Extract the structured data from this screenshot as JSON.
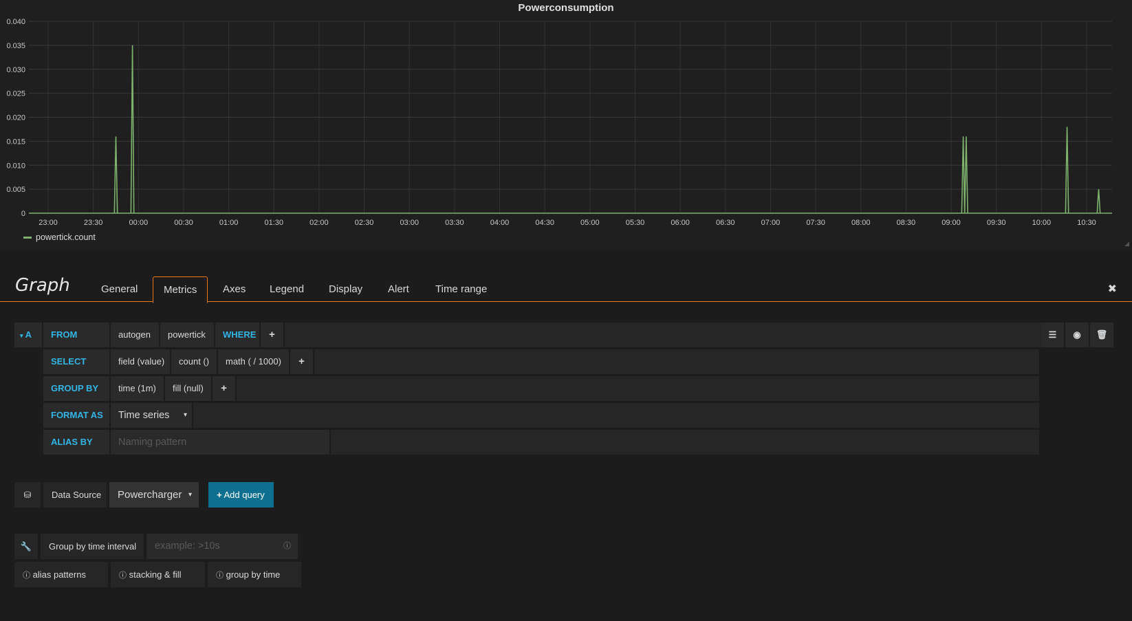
{
  "panel": {
    "title": "Powerconsumption",
    "legend_label": "powertick.count",
    "series_color": "#7eb26d"
  },
  "chart_data": {
    "type": "line",
    "x_ticks": [
      "23:00",
      "23:30",
      "00:00",
      "00:30",
      "01:00",
      "01:30",
      "02:00",
      "02:30",
      "03:00",
      "03:30",
      "04:00",
      "04:30",
      "05:00",
      "05:30",
      "06:00",
      "06:30",
      "07:00",
      "07:30",
      "08:00",
      "08:30",
      "09:00",
      "09:30",
      "10:00",
      "10:30"
    ],
    "y_ticks": [
      "0",
      "0.005",
      "0.010",
      "0.015",
      "0.020",
      "0.025",
      "0.030",
      "0.035",
      "0.040"
    ],
    "ylim": [
      0,
      0.04
    ],
    "grid": true,
    "series": [
      {
        "name": "powertick.count",
        "points": [
          [
            "23:44",
            0
          ],
          [
            "23:45",
            0.016
          ],
          [
            "23:46",
            0
          ],
          [
            "23:55",
            0
          ],
          [
            "23:56",
            0.035
          ],
          [
            "23:57",
            0
          ],
          [
            "09:07",
            0
          ],
          [
            "09:08",
            0.016
          ],
          [
            "09:09",
            0
          ],
          [
            "09:10",
            0.016
          ],
          [
            "09:11",
            0
          ],
          [
            "10:16",
            0
          ],
          [
            "10:17",
            0.018
          ],
          [
            "10:18",
            0
          ],
          [
            "10:37",
            0
          ],
          [
            "10:38",
            0.005
          ],
          [
            "10:39",
            0
          ]
        ]
      }
    ]
  },
  "editor": {
    "title": "Graph",
    "tabs": [
      "General",
      "Metrics",
      "Axes",
      "Legend",
      "Display",
      "Alert",
      "Time range"
    ],
    "active_tab": "Metrics",
    "query": {
      "ref": "A",
      "from_label": "FROM",
      "policy": "autogen",
      "measurement": "powertick",
      "where_label": "WHERE",
      "select_label": "SELECT",
      "select_parts": [
        "field (value)",
        "count ()",
        "math ( / 1000)"
      ],
      "group_by_label": "GROUP BY",
      "group_by_parts": [
        "time (1m)",
        "fill (null)"
      ],
      "format_as_label": "FORMAT AS",
      "format_as_value": "Time series",
      "alias_by_label": "ALIAS BY",
      "alias_placeholder": "Naming pattern"
    },
    "datasource": {
      "label": "Data Source",
      "value": "Powercharger",
      "add_query": "Add query"
    },
    "options": {
      "interval_label": "Group by time interval",
      "interval_placeholder": "example: >10s",
      "help": [
        "alias patterns",
        "stacking & fill",
        "group by time"
      ]
    }
  }
}
